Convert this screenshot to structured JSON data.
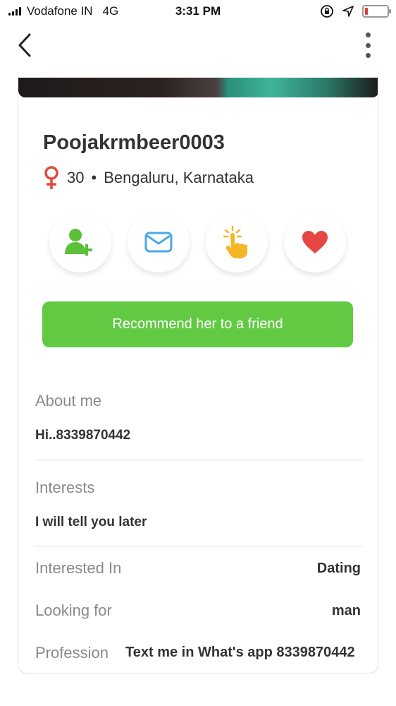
{
  "status_bar": {
    "carrier": "Vodafone IN",
    "network": "4G",
    "time": "3:31 PM",
    "signal_bars": 4,
    "battery_level": 0.12
  },
  "nav": {
    "back_icon": "chevron-left-icon",
    "more_icon": "more-vertical-icon"
  },
  "profile": {
    "name": "Poojakrmbeer0003",
    "gender_icon": "female-symbol-icon",
    "age": "30",
    "separator": "•",
    "location": "Bengaluru, Karnataka"
  },
  "actions": [
    {
      "name": "add-friend-button",
      "icon": "add-user-icon",
      "color": "#5cbf3a"
    },
    {
      "name": "message-button",
      "icon": "envelope-icon",
      "color": "#4aa8e8"
    },
    {
      "name": "poke-button",
      "icon": "tap-hand-icon",
      "color": "#f4b625"
    },
    {
      "name": "like-button",
      "icon": "heart-icon",
      "color": "#e84545"
    }
  ],
  "recommend_label": "Recommend her to a friend",
  "about": {
    "label": "About me",
    "value": "Hi..8339870442"
  },
  "interests": {
    "label": "Interests",
    "value": "I will tell you later"
  },
  "details": [
    {
      "label": "Interested In",
      "value": "Dating"
    },
    {
      "label": "Looking for",
      "value": "man"
    },
    {
      "label": "Profession",
      "value": "Text  me in What's app 8339870442"
    }
  ],
  "colors": {
    "accent_green": "#62c943",
    "gender_red": "#e24b3c"
  }
}
